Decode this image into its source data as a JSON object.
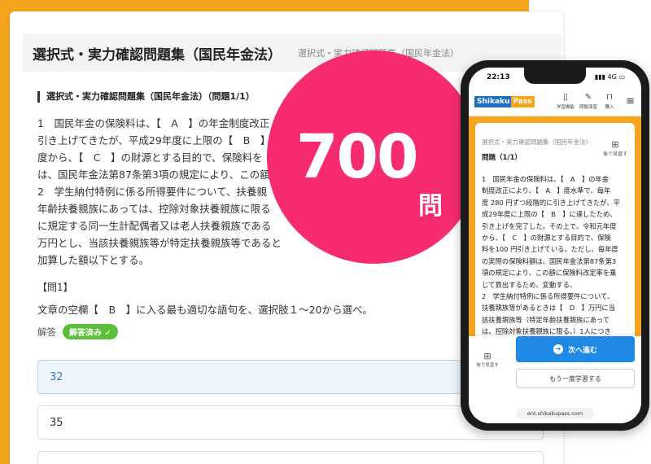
{
  "desktop": {
    "title": "選択式・実力確認問題集（国民年金法）",
    "subtitle": "選択式・実力確認問題集（国民年金法）",
    "question_heading": "選択式・実力確認問題集（国民年金法）（問題1/1）",
    "question_lines": [
      "1　国民年金の保険料は、【　A　】の年金制度改正",
      "引き上げてきたが、平成29年度に上限の【　B　】",
      "度から、【　C　】の財源とする目的で、保険料を",
      "は、国民年金法第87条第3項の規定により、この額",
      "2　学生納付特例に係る所得要件について、扶養親",
      "年齢扶養親族にあっては、控除対象扶養親族に限る",
      "に規定する同一生計配偶者又は老人扶養親族である",
      "万円とし、当該扶養親族等が特定扶養親族等であると",
      "加算した額以下とする。"
    ],
    "question_number": "【問1】",
    "instruction": "文章の空欄【　B　】に入る最も適切な語句を、選択肢１～20から選べ。",
    "answer_label": "解答",
    "answered_badge": "解答済み ✓",
    "options": [
      "32",
      "35",
      ""
    ]
  },
  "badge": {
    "number": "700",
    "unit": "問"
  },
  "phone": {
    "time": "22:13",
    "network": "4G",
    "logo_left": "Shikaku",
    "logo_right": "Pass",
    "nav": [
      "学習機能",
      "問題演習",
      "購入"
    ],
    "subtitle": "選択式・実力確認問題集（国民年金法）",
    "question_title": "問題（1/1）",
    "later_label": "後で見直す",
    "text_lines": [
      "1　国民年金の保険料は、【　A　】の年金",
      "制度改正により、【　A　】度水準で、毎年",
      "度 280 円ずつ段階的に引き上げてきたが、平",
      "成29年度に上限の【　B　】に達したため、",
      "引き上げを完了した。その上で、令和元年度",
      "から、【　C　】の財源とする目的で、保険",
      "料を100 円引き上げている。ただし、毎年度",
      "の実際の保険料額は、国民年金法第87条第3",
      "項の規定により、この額に保険料改定率を乗",
      "じて算出するため、変動する。",
      "2　学生納付特例に係る所得要件について、",
      "扶養親族等があるときは【　D　】万円に当",
      "該扶養親族等（特定年齢扶養親族にあって",
      "は、控除対象扶養親族に限る。）1人につき"
    ],
    "later_label_bottom": "後で見直す",
    "next_button": "次へ進む",
    "retry_button": "もう一度学習する",
    "url": "ent.shikakupass.com"
  }
}
